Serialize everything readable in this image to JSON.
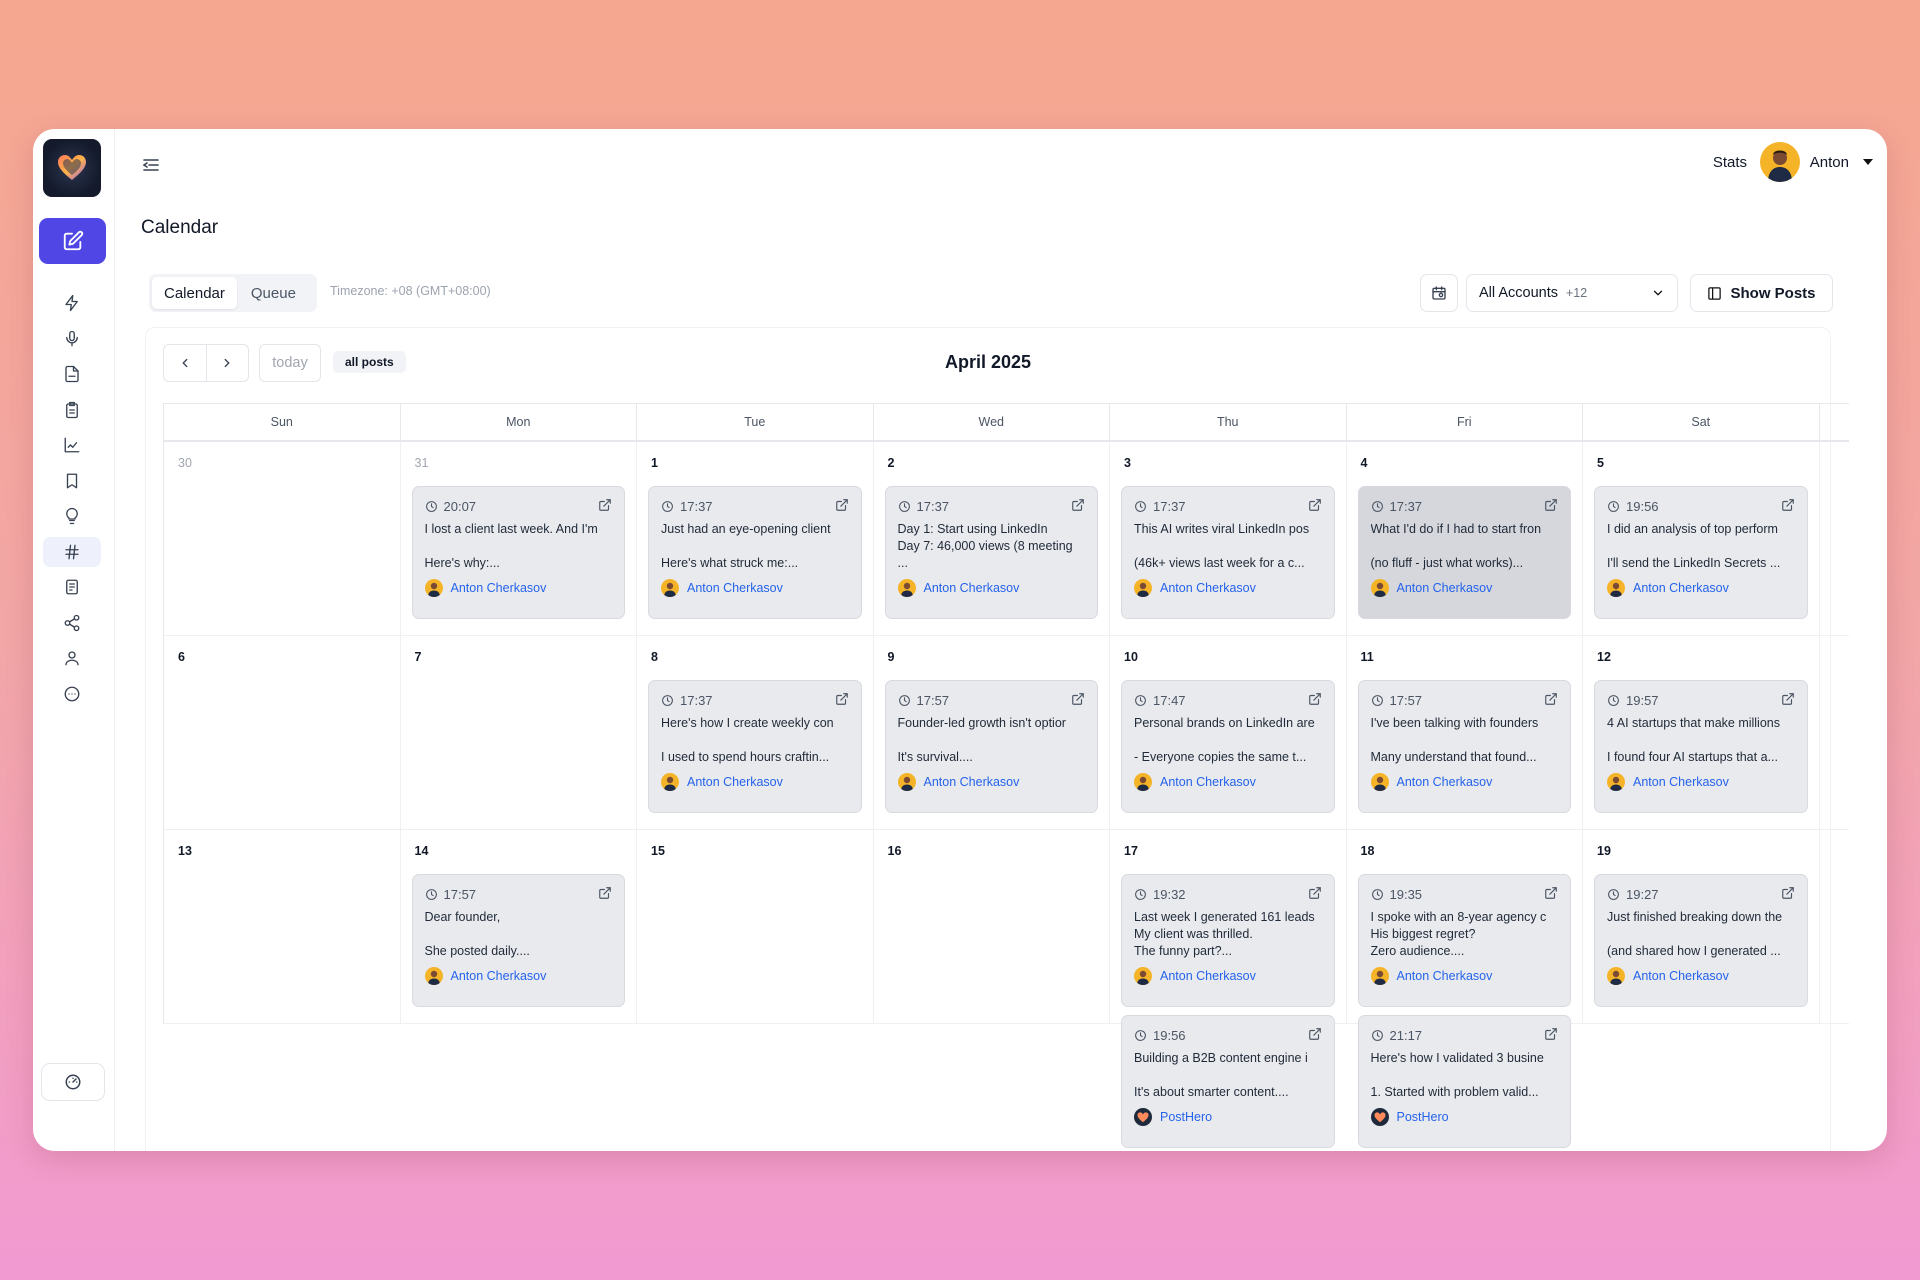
{
  "app": {
    "page_title": "Calendar"
  },
  "header": {
    "stats_label": "Stats",
    "user_name": "Anton"
  },
  "toolbar": {
    "tabs": [
      {
        "label": "Calendar",
        "active": true
      },
      {
        "label": "Queue",
        "active": false
      }
    ],
    "timezone": "Timezone: +08 (GMT+08:00)",
    "accounts_label": "All Accounts",
    "accounts_extra": "+12",
    "show_posts_label": "Show Posts"
  },
  "calendar": {
    "month_label": "April 2025",
    "today_label": "today",
    "filter_label": "all posts",
    "weekdays": [
      "Sun",
      "Mon",
      "Tue",
      "Wed",
      "Thu",
      "Fri",
      "Sat"
    ],
    "weeks": [
      [
        {
          "day": "30",
          "muted": true,
          "posts": []
        },
        {
          "day": "31",
          "muted": true,
          "posts": [
            {
              "time": "20:07",
              "lines": [
                "I lost a client last week. And I'm",
                "",
                "Here's why:..."
              ],
              "author": "Anton Cherkasov",
              "author_type": "person"
            }
          ]
        },
        {
          "day": "1",
          "posts": [
            {
              "time": "17:37",
              "lines": [
                "Just had an eye-opening client",
                "",
                "Here's what struck me:..."
              ],
              "author": "Anton Cherkasov",
              "author_type": "person"
            }
          ]
        },
        {
          "day": "2",
          "posts": [
            {
              "time": "17:37",
              "lines": [
                "Day 1: Start using LinkedIn",
                "Day 7: 46,000 views (8 meeting",
                "..."
              ],
              "author": "Anton Cherkasov",
              "author_type": "person"
            }
          ]
        },
        {
          "day": "3",
          "posts": [
            {
              "time": "17:37",
              "lines": [
                "This AI writes viral LinkedIn pos",
                "",
                "(46k+ views last week for a c..."
              ],
              "author": "Anton Cherkasov",
              "author_type": "person"
            }
          ]
        },
        {
          "day": "4",
          "posts": [
            {
              "time": "17:37",
              "lines": [
                "What I'd do if I had to start fron",
                "",
                "(no fluff - just what works)..."
              ],
              "author": "Anton Cherkasov",
              "author_type": "person",
              "highlighted": true
            }
          ]
        },
        {
          "day": "5",
          "posts": [
            {
              "time": "19:56",
              "lines": [
                "I did an analysis of top perform",
                "",
                "I'll send the LinkedIn Secrets ..."
              ],
              "author": "Anton Cherkasov",
              "author_type": "person"
            }
          ]
        }
      ],
      [
        {
          "day": "6",
          "posts": []
        },
        {
          "day": "7",
          "posts": []
        },
        {
          "day": "8",
          "posts": [
            {
              "time": "17:37",
              "lines": [
                "Here's how I create weekly con",
                "",
                "I used to spend hours craftin..."
              ],
              "author": "Anton Cherkasov",
              "author_type": "person"
            }
          ]
        },
        {
          "day": "9",
          "posts": [
            {
              "time": "17:57",
              "lines": [
                "Founder-led growth isn't optior",
                "",
                "It's survival...."
              ],
              "author": "Anton Cherkasov",
              "author_type": "person"
            }
          ]
        },
        {
          "day": "10",
          "posts": [
            {
              "time": "17:47",
              "lines": [
                "Personal brands on LinkedIn are",
                "",
                "- Everyone copies the same t..."
              ],
              "author": "Anton Cherkasov",
              "author_type": "person"
            }
          ]
        },
        {
          "day": "11",
          "posts": [
            {
              "time": "17:57",
              "lines": [
                "I've been talking with founders",
                "",
                "Many understand that found..."
              ],
              "author": "Anton Cherkasov",
              "author_type": "person"
            }
          ]
        },
        {
          "day": "12",
          "posts": [
            {
              "time": "19:57",
              "lines": [
                "4 AI startups that make millions",
                "",
                "I found four AI startups that a..."
              ],
              "author": "Anton Cherkasov",
              "author_type": "person"
            }
          ]
        }
      ],
      [
        {
          "day": "13",
          "posts": []
        },
        {
          "day": "14",
          "posts": [
            {
              "time": "17:57",
              "lines": [
                "Dear founder,",
                "",
                "She posted daily...."
              ],
              "author": "Anton Cherkasov",
              "author_type": "person"
            }
          ]
        },
        {
          "day": "15",
          "posts": []
        },
        {
          "day": "16",
          "posts": []
        },
        {
          "day": "17",
          "posts": [
            {
              "time": "19:32",
              "lines": [
                "Last week I generated 161 leads",
                "My client was thrilled.",
                "The funny part?..."
              ],
              "author": "Anton Cherkasov",
              "author_type": "person"
            },
            {
              "time": "19:56",
              "lines": [
                "Building a B2B content engine i",
                "",
                "It's about smarter content...."
              ],
              "author": "PostHero",
              "author_type": "brand"
            }
          ]
        },
        {
          "day": "18",
          "posts": [
            {
              "time": "19:35",
              "lines": [
                "I spoke with an 8-year agency c",
                "His biggest regret?",
                "Zero audience...."
              ],
              "author": "Anton Cherkasov",
              "author_type": "person"
            },
            {
              "time": "21:17",
              "lines": [
                "Here's how I validated 3 busine",
                "",
                "1. Started with problem valid..."
              ],
              "author": "PostHero",
              "author_type": "brand"
            }
          ]
        },
        {
          "day": "19",
          "posts": [
            {
              "time": "19:27",
              "lines": [
                "Just finished breaking down the",
                "",
                "(and shared how I generated ..."
              ],
              "author": "Anton Cherkasov",
              "author_type": "person"
            }
          ]
        }
      ]
    ]
  },
  "colors": {
    "accent": "#4f46e5",
    "link": "#2563eb",
    "card_bg": "#e9eaee",
    "card_highlight": "#d5d7dd"
  },
  "sidebar_icons": [
    "bolt-icon",
    "microphone-icon",
    "pdf-file-icon",
    "clipboard-icon",
    "analytics-chart-icon",
    "bookmark-icon",
    "lightbulb-icon",
    "hashtag-icon",
    "document-list-icon",
    "share-icon",
    "user-icon",
    "chat-bubble-icon"
  ]
}
